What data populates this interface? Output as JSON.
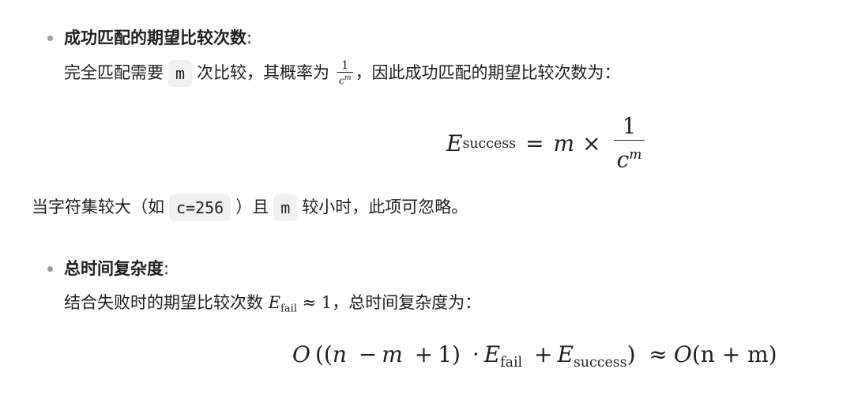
{
  "sections": [
    {
      "title": "成功匹配的期望比较次数",
      "colon": ":",
      "line_parts": [
        "完全匹配需要",
        "m",
        "次比较，其概率为",
        "，因此成功匹配的期望比较次数为："
      ],
      "inline_frac": {
        "num": "1",
        "den_base": "c",
        "den_sup": "m"
      },
      "formula": {
        "lhs": "E",
        "lhs_sub": "success",
        "eq": "=",
        "m": "m",
        "times": "×",
        "frac_num": "1",
        "frac_den_base": "c",
        "frac_den_sup": "m"
      }
    }
  ],
  "note": {
    "parts": [
      "当字符集较大（如",
      "c=256",
      "）且",
      "m",
      "较小时，此项可忽略。"
    ]
  },
  "section2": {
    "title": "总时间复杂度",
    "colon": ":",
    "line_parts": [
      "结合失败时的期望比较次数",
      "，总时间复杂度为："
    ],
    "inline_math": {
      "E": "E",
      "sub": "fail",
      "approx": "≈",
      "one": "1"
    },
    "formula": {
      "O1": "O",
      "open": "((",
      "n": "n",
      "minus": "−",
      "m": "m",
      "plus1": "+",
      "one": "1",
      "close1": ")",
      "cdot": "·",
      "E1": "E",
      "sub1": "fail",
      "plus2": "+",
      "E2": "E",
      "sub2": "success",
      "close2": ")",
      "approx": "≈",
      "O2": "O",
      "rhs": "(n + m)"
    }
  }
}
